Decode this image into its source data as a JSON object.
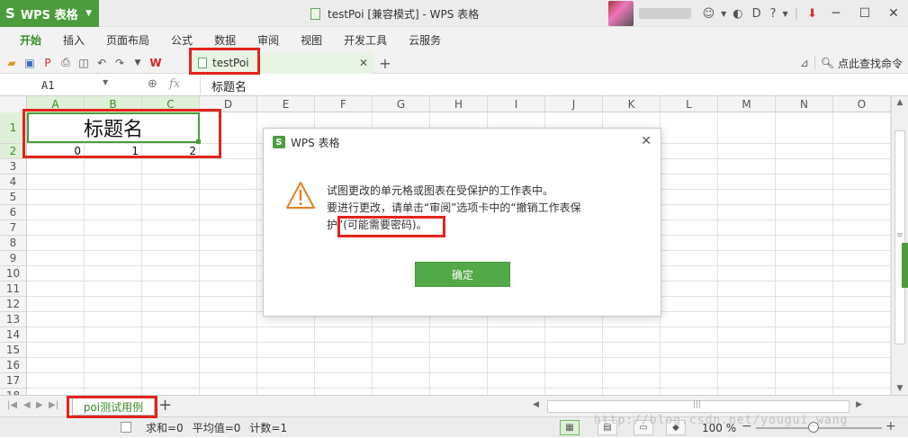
{
  "app": {
    "name": "WPS 表格"
  },
  "window": {
    "title": "testPoi [兼容模式] - WPS 表格"
  },
  "menu": {
    "tabs": [
      "开始",
      "插入",
      "页面布局",
      "公式",
      "数据",
      "审阅",
      "视图",
      "开发工具",
      "云服务"
    ],
    "active_index": 0
  },
  "doc_tab": {
    "name": "testPoi"
  },
  "toolbar": {
    "find_command": "点此查找命令"
  },
  "formula_bar": {
    "cell_ref": "A1",
    "fx_label": "fx",
    "value": "标题名"
  },
  "grid": {
    "columns": [
      "A",
      "B",
      "C",
      "D",
      "E",
      "F",
      "G",
      "H",
      "I",
      "J",
      "K",
      "L",
      "M",
      "N",
      "O"
    ],
    "rows": [
      "1",
      "2",
      "3",
      "4",
      "5",
      "6",
      "7",
      "8",
      "9",
      "10",
      "11",
      "12",
      "13",
      "14",
      "15",
      "16",
      "17",
      "18"
    ],
    "merged_title": "标题名",
    "row2_values": [
      "0",
      "1",
      "2"
    ]
  },
  "dialog": {
    "title": "WPS 表格",
    "message_line1": "试图更改的单元格或图表在受保护的工作表中。",
    "message_line2": "要进行更改，请单击“审阅”选项卡中的“撤销工作表保",
    "message_line3": "护”(可能需要密码)。",
    "ok_label": "确定"
  },
  "sheets": {
    "tabs": [
      "poi测试用例"
    ],
    "active_index": 0
  },
  "status": {
    "sum": "求和=0",
    "avg": "平均值=0",
    "count": "计数=1",
    "zoom": "100 %"
  },
  "watermark": "http://blog.csdn.net/yougui_wang",
  "colors": {
    "accent": "#4c9c3d",
    "annotation": "#e2241b"
  }
}
